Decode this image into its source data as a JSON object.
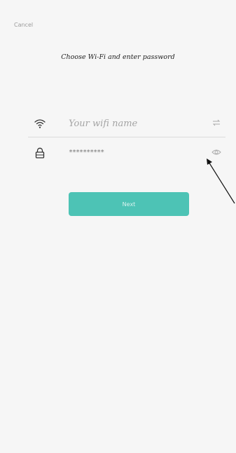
{
  "header": {
    "cancel_label": "Cancel",
    "title": "Choose Wi-Fi and enter password"
  },
  "wifi": {
    "placeholder": "Your wifi name",
    "icon": "wifi-icon",
    "right_icon": "switch-icon"
  },
  "password": {
    "value": "**********",
    "icon": "lock-icon",
    "toggle_icon": "eye-icon"
  },
  "next_label": "Next",
  "colors": {
    "accent": "#4dc3b5",
    "background": "#f6f6f6"
  }
}
